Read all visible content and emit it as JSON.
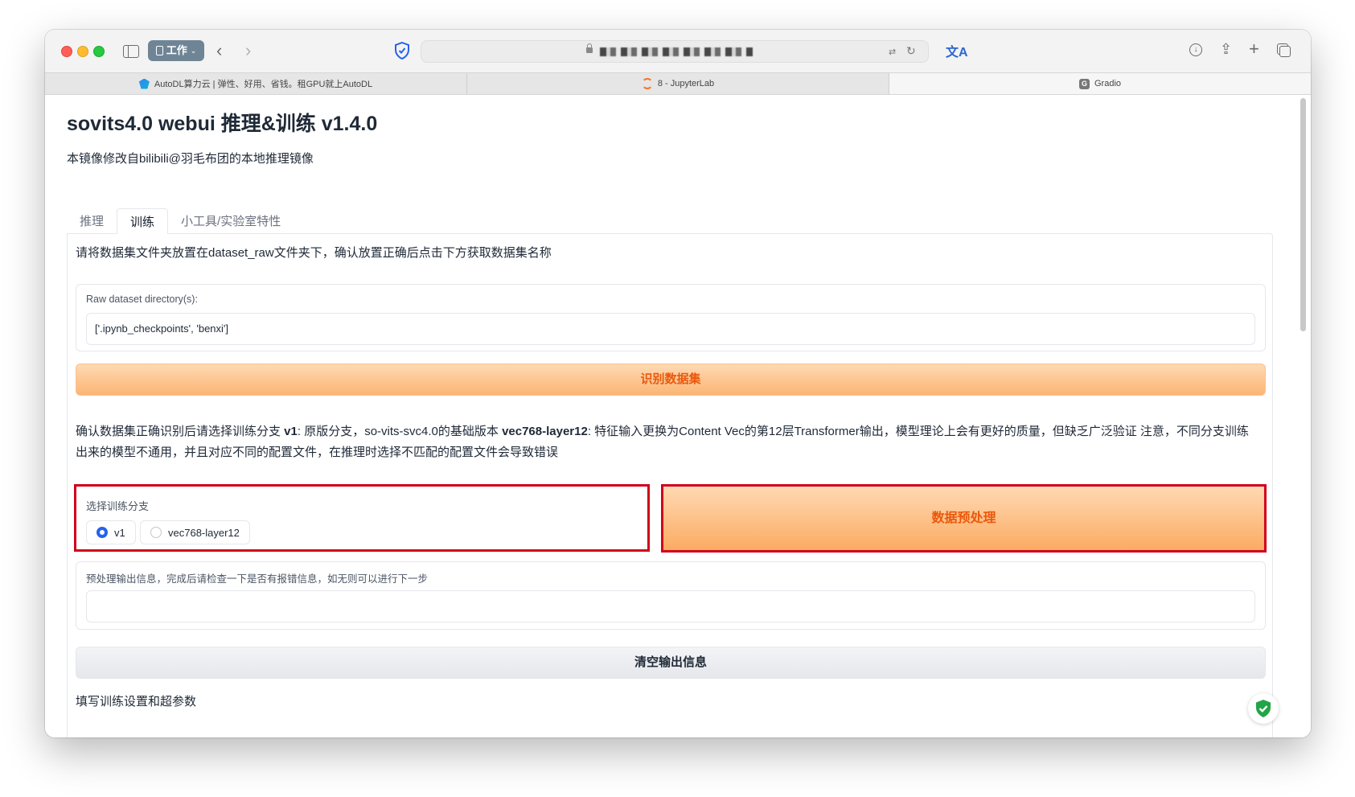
{
  "browser": {
    "profile_label": "工作",
    "tabs": [
      {
        "title": "AutoDL算力云 | 弹性、好用、省钱。租GPU就上AutoDL",
        "icon": "autodl-icon"
      },
      {
        "title": "8 - JupyterLab",
        "icon": "jupyter-icon"
      },
      {
        "title": "Gradio",
        "icon": "gradio-icon",
        "icon_letter": "G"
      }
    ]
  },
  "app": {
    "title": "sovits4.0 webui 推理&训练 v1.4.0",
    "subtitle": "本镜像修改自bilibili@羽毛布团的本地推理镜像"
  },
  "tabs": [
    {
      "label": "推理",
      "active": false
    },
    {
      "label": "训练",
      "active": true
    },
    {
      "label": "小工具/实验室特性",
      "active": false
    }
  ],
  "train": {
    "instruction": "请将数据集文件夹放置在dataset_raw文件夹下，确认放置正确后点击下方获取数据集名称",
    "raw_dir_label": "Raw dataset directory(s):",
    "raw_dir_value": "['.ipynb_checkpoints', 'benxi']",
    "identify_button": "识别数据集",
    "branch_instruction": {
      "t1": "确认数据集正确识别后请选择训练分支 ",
      "b1": "v1",
      "t2": ": 原版分支，so-vits-svc4.0的基础版本 ",
      "b2": "vec768-layer12",
      "t3": ": 特征输入更换为Content Vec的第12层Transformer输出，模型理论上会有更好的质量，但缺乏广泛验证 注意，不同分支训练出来的模型不通用，并且对应不同的配置文件，在推理时选择不匹配的配置文件会导致错误"
    },
    "branch_label": "选择训练分支",
    "branch_options": [
      "v1",
      "vec768-layer12"
    ],
    "branch_selected": "v1",
    "preprocess_button": "数据预处理",
    "output_label": "预处理输出信息，完成后请检查一下是否有报错信息，如无则可以进行下一步",
    "output_value": "",
    "clear_button": "清空输出信息",
    "settings_heading": "填写训练设置和超参数"
  },
  "colors": {
    "accent_orange": "#ea580c",
    "highlight_red": "#d0021b",
    "radio_blue": "#2563eb"
  }
}
